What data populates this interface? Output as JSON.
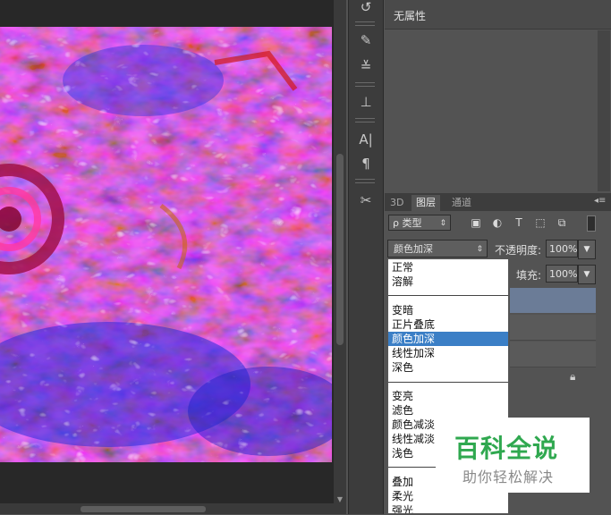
{
  "properties": {
    "title": "无属性"
  },
  "tools": [
    {
      "icon": "history-icon",
      "glyph": "↺"
    },
    {
      "icon": "brush-presets-icon",
      "glyph": "✎"
    },
    {
      "icon": "adjustments-icon",
      "glyph": "≚"
    },
    {
      "icon": "clone-source-icon",
      "glyph": "⊥"
    },
    {
      "icon": "character-icon",
      "glyph": "A|"
    },
    {
      "icon": "paragraph-icon",
      "glyph": "¶"
    },
    {
      "icon": "tools-icon",
      "glyph": "✂"
    }
  ],
  "layers_panel": {
    "tabs": [
      "3D",
      "图层",
      "通道"
    ],
    "active_tab": "图层",
    "filter_label": "ρ 类型",
    "filter_icons": [
      {
        "icon": "pixel-filter-icon",
        "glyph": "▣"
      },
      {
        "icon": "adjustment-filter-icon",
        "glyph": "◐"
      },
      {
        "icon": "type-filter-icon",
        "glyph": "T"
      },
      {
        "icon": "shape-filter-icon",
        "glyph": "⬚"
      },
      {
        "icon": "smart-object-filter-icon",
        "glyph": "⧉"
      }
    ],
    "blend_mode": "颜色加深",
    "opacity_label": "不透明度:",
    "opacity_value": "100%",
    "fill_label": "填充:",
    "fill_value": "100%"
  },
  "blend_menu": {
    "groups": [
      [
        "正常",
        "溶解"
      ],
      [
        "变暗",
        "正片叠底",
        "颜色加深",
        "线性加深",
        "深色"
      ],
      [
        "变亮",
        "滤色",
        "颜色减淡",
        "线性减淡",
        "浅色"
      ],
      [
        "叠加",
        "柔光",
        "强光"
      ]
    ],
    "selected": "颜色加深"
  },
  "watermark": {
    "title": "百科全说",
    "subtitle": "助你轻松解决"
  },
  "colors": {
    "menu_selected": "#3b7fc6",
    "layer_selected": "#6b7c97",
    "watermark_green": "#2fa84f"
  }
}
